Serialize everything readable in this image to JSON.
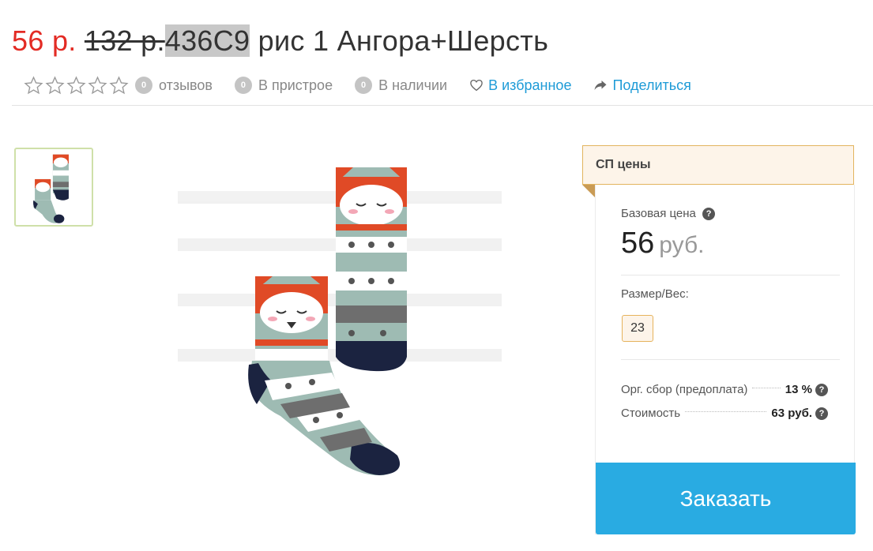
{
  "product": {
    "price_new": "56 р.",
    "price_old": "132 р.",
    "sku": "436С9",
    "title_rest": " рис 1 Ангора+Шерсть"
  },
  "meta": {
    "reviews_count": "0",
    "reviews_label": "отзывов",
    "attach_count": "0",
    "attach_label": "В пристрое",
    "stock_count": "0",
    "stock_label": "В наличии",
    "favorite_label": "В избранное",
    "share_label": "Поделиться"
  },
  "panel": {
    "header": "СП цены",
    "base_price_label": "Базовая цена",
    "base_price_value": "56",
    "base_price_currency": "руб.",
    "size_label": "Размер/Вес:",
    "size_value": "23",
    "org_fee_label": "Орг. сбор (предоплата)",
    "org_fee_value": "13 %",
    "cost_label": "Стоимость",
    "cost_value": "63 руб.",
    "order_button": "Заказать"
  },
  "colors": {
    "price_red": "#e32b24",
    "link_blue": "#1e9bd7",
    "order_blue": "#29abe2",
    "accent_orange": "#e2b45e"
  }
}
